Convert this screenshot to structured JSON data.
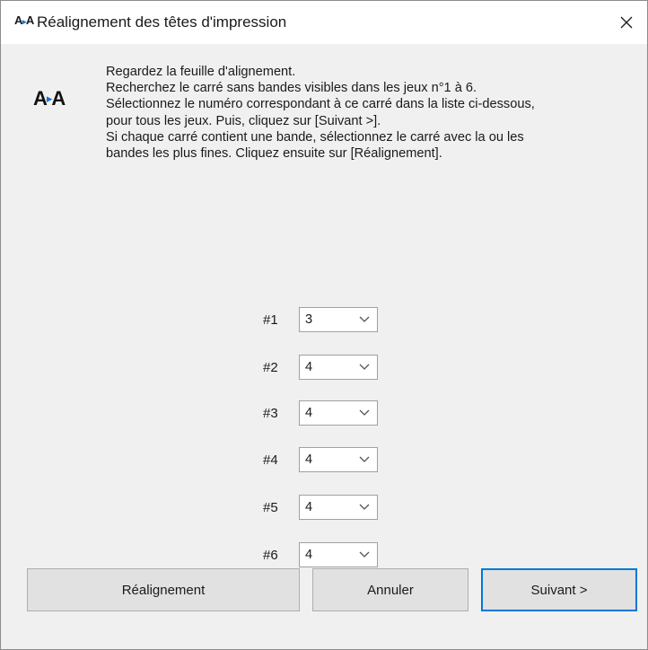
{
  "window": {
    "title": "Réalignement des têtes d'impression",
    "title_icon": "printhead-align-icon",
    "close_icon": "close-icon"
  },
  "logo": {
    "left": "A",
    "right": "A",
    "icon": "printhead-align-icon"
  },
  "instructions": [
    "Regardez la feuille d'alignement.",
    "Recherchez le carré sans bandes visibles dans les jeux n°1 à 6.",
    "Sélectionnez le numéro correspondant à ce carré dans la liste ci-dessous,",
    "pour tous les jeux. Puis, cliquez sur [Suivant >].",
    "Si chaque carré contient une bande, sélectionnez le carré avec la ou les",
    "bandes les plus fines. Cliquez ensuite sur [Réalignement]."
  ],
  "sets": [
    {
      "label": "#1",
      "value": "3"
    },
    {
      "label": "#2",
      "value": "4"
    },
    {
      "label": "#3",
      "value": "4"
    },
    {
      "label": "#4",
      "value": "4"
    },
    {
      "label": "#5",
      "value": "4"
    },
    {
      "label": "#6",
      "value": "4"
    }
  ],
  "buttons": {
    "realign": "Réalignement",
    "cancel": "Annuler",
    "next": "Suivant >"
  },
  "colors": {
    "accent": "#0078d7",
    "logo_arrow": "#1f6fd0"
  }
}
